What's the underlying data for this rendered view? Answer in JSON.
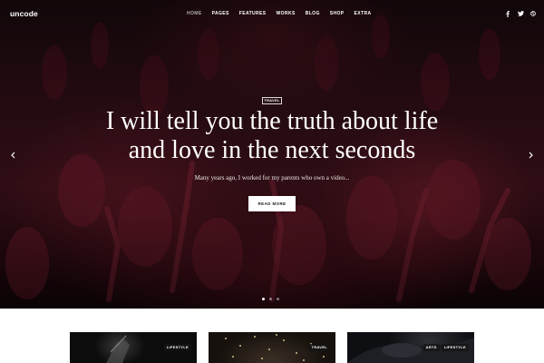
{
  "brand": {
    "logo_text": "uncode"
  },
  "nav": {
    "items": [
      {
        "label": "HOME",
        "active": true
      },
      {
        "label": "PAGES",
        "active": false
      },
      {
        "label": "FEATURES",
        "active": false
      },
      {
        "label": "WORKS",
        "active": false
      },
      {
        "label": "BLOG",
        "active": false
      },
      {
        "label": "SHOP",
        "active": false
      },
      {
        "label": "EXTRA",
        "active": false
      }
    ]
  },
  "social": {
    "icons": [
      "facebook-icon",
      "twitter-icon",
      "dribbble-icon"
    ]
  },
  "hero": {
    "category": "TRAVEL",
    "headline_line1": "I will tell you the truth about life",
    "headline_line2": "and love in the next seconds",
    "excerpt": "Many years ago, I worked for my parents who own a video...",
    "cta_label": "READ MORE",
    "slides_total": 3,
    "active_slide": 1,
    "accent_color": "#5a1422"
  },
  "cards": [
    {
      "tags": [
        "LIFESTYLE"
      ]
    },
    {
      "tags": [
        "TRAVEL"
      ]
    },
    {
      "tags": [
        "ARTS",
        "LIFESTYLE"
      ]
    }
  ]
}
